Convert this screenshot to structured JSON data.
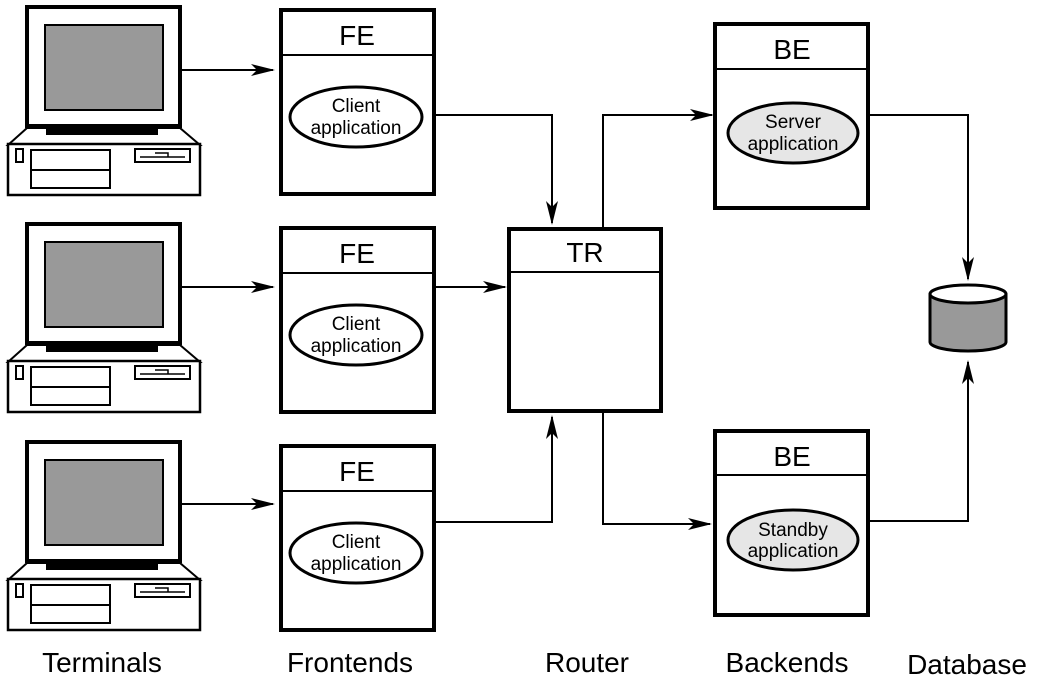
{
  "frontends": [
    {
      "title": "FE",
      "app_line1": "Client",
      "app_line2": "application"
    },
    {
      "title": "FE",
      "app_line1": "Client",
      "app_line2": "application"
    },
    {
      "title": "FE",
      "app_line1": "Client",
      "app_line2": "application"
    }
  ],
  "router": {
    "title": "TR"
  },
  "backends": [
    {
      "title": "BE",
      "app_line1": "Server",
      "app_line2": "application"
    },
    {
      "title": "BE",
      "app_line1": "Standby",
      "app_line2": "application"
    }
  ],
  "labels": {
    "terminals": "Terminals",
    "frontends": "Frontends",
    "router": "Router",
    "backends": "Backends",
    "database": "Database"
  },
  "colors": {
    "screen": "#999999",
    "backend_app_fill": "#e6e6e6",
    "database_fill": "#999999"
  },
  "icons": [
    "computer-terminal-icon",
    "database-cylinder-icon"
  ]
}
